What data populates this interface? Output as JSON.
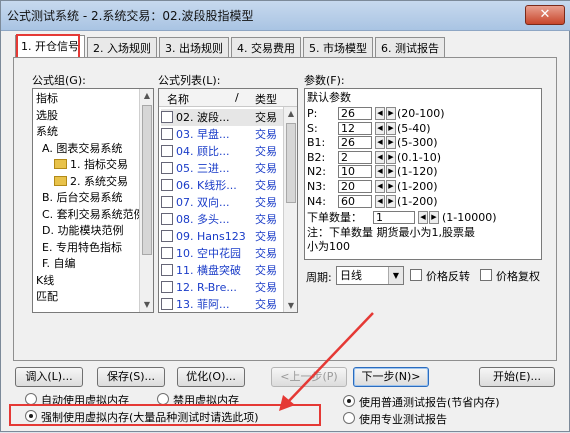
{
  "window": {
    "title": "公式测试系统 - 2.系统交易：02.波段股指模型",
    "close_label": "✕"
  },
  "tabs": [
    "1. 开仓信号",
    "2. 入场规则",
    "3. 出场规则",
    "4. 交易费用",
    "5. 市场模型",
    "6. 测试报告"
  ],
  "formula_group": {
    "label": "公式组(G):",
    "items": [
      "指标",
      "选股",
      "系统",
      "A. 图表交易系统",
      "1. 指标交易",
      "2. 系统交易",
      "B. 后台交易系统",
      "C. 套利交易系统范例",
      "D. 功能模块范例",
      "E. 专用特色指标",
      "F. 自编",
      "K线",
      "匹配"
    ]
  },
  "formula_list": {
    "label": "公式列表(L):",
    "col_name": "名称",
    "col_slash": "/",
    "col_type": "类型",
    "rows": [
      {
        "name": "02. 波段...",
        "type": "交易"
      },
      {
        "name": "03. 早盘...",
        "type": "交易"
      },
      {
        "name": "04. 顾比...",
        "type": "交易"
      },
      {
        "name": "05. 三进...",
        "type": "交易"
      },
      {
        "name": "06. K线形...",
        "type": "交易"
      },
      {
        "name": "07. 双向...",
        "type": "交易"
      },
      {
        "name": "08. 多头...",
        "type": "交易"
      },
      {
        "name": "09. Hans123",
        "type": "交易"
      },
      {
        "name": "10. 空中花园",
        "type": "交易"
      },
      {
        "name": "11. 横盘突破",
        "type": "交易"
      },
      {
        "name": "12. R-Bre...",
        "type": "交易"
      },
      {
        "name": "13. 菲阿...",
        "type": "交易"
      }
    ]
  },
  "params": {
    "label": "参数(F):",
    "heading": "默认参数",
    "rows": [
      {
        "name": "P:",
        "value": "26",
        "range": "(20-100)"
      },
      {
        "name": "S:",
        "value": "12",
        "range": "(5-40)"
      },
      {
        "name": "B1:",
        "value": "26",
        "range": "(5-300)"
      },
      {
        "name": "B2:",
        "value": "2",
        "range": "(0.1-10)"
      },
      {
        "name": "N2:",
        "value": "10",
        "range": "(1-120)"
      },
      {
        "name": "N3:",
        "value": "20",
        "range": "(1-200)"
      },
      {
        "name": "N4:",
        "value": "60",
        "range": "(1-200)"
      }
    ],
    "order_label": "下单数量：",
    "order_value": "1",
    "order_range": "(1-10000)",
    "note_line1": "注：下单数量 期货最小为1,股票最",
    "note_line2": "小为100"
  },
  "period": {
    "label": "周期:",
    "value": "日线"
  },
  "checks": {
    "price_reverse": "价格反转",
    "price_restore": "价格复权"
  },
  "buttons": {
    "import": "调入(L)...",
    "save": "保存(S)...",
    "optimize": "优化(O)...",
    "prev": "<上一步(P)",
    "next": "下一步(N)>",
    "start": "开始(E)..."
  },
  "memory_options": {
    "auto": "自动使用虚拟内存",
    "disable": "禁用虚拟内存",
    "force": "强制使用虚拟内存(大量品种测试时请选此项)"
  },
  "report_options": {
    "normal": "使用普通测试报告(节省内存)",
    "pro": "使用专业测试报告"
  },
  "colors": {
    "annotation_red": "#e53935",
    "link_blue": "#1a3cc8"
  }
}
